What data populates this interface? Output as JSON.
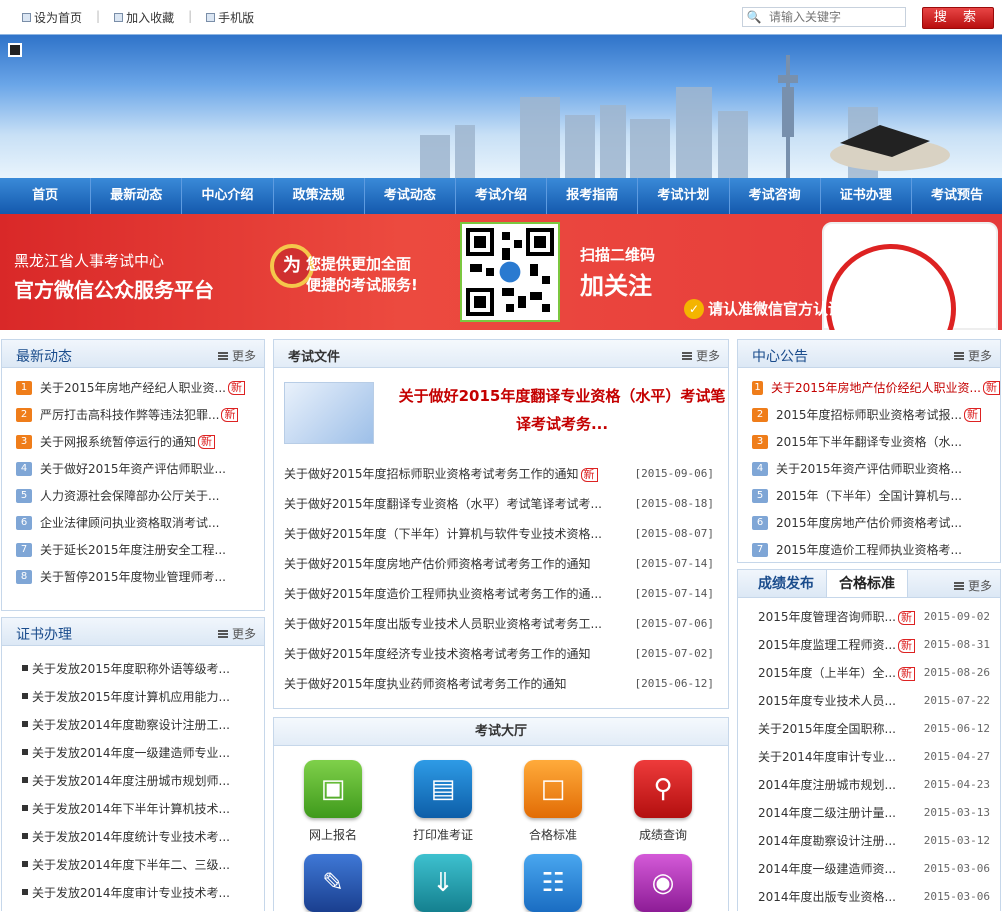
{
  "toplinks": {
    "home": "设为首页",
    "fav": "加入收藏",
    "mobile": "手机版"
  },
  "search": {
    "placeholder": "请输入关键字",
    "button": "搜 索"
  },
  "nav": [
    "首页",
    "最新动态",
    "中心介绍",
    "政策法规",
    "考试动态",
    "考试介绍",
    "报考指南",
    "考试计划",
    "考试咨询",
    "证书办理",
    "考试预告"
  ],
  "wechat": {
    "org": "黑龙江省人事考试中心",
    "platform": "官方微信公众服务平台",
    "badge": "为",
    "slogan1": "您提供更加全面",
    "slogan2": "便捷的考试服务!",
    "scan1": "扫描二维码",
    "scan2": "加关注",
    "verify": "请认准微信官方认证"
  },
  "latest": {
    "title": "最新动态",
    "more": "更多",
    "items": [
      {
        "n": "1",
        "t": "关于2015年房地产经纪人职业资...",
        "new": "新"
      },
      {
        "n": "2",
        "t": "严厉打击高科技作弊等违法犯罪...",
        "new": "新"
      },
      {
        "n": "3",
        "t": "关于网报系统暂停运行的通知",
        "new": "新"
      },
      {
        "n": "4",
        "t": "关于做好2015年资产评估师职业...",
        "new": ""
      },
      {
        "n": "5",
        "t": "人力资源社会保障部办公厅关于...",
        "new": ""
      },
      {
        "n": "6",
        "t": "企业法律顾问执业资格取消考试...",
        "new": ""
      },
      {
        "n": "7",
        "t": "关于延长2015年度注册安全工程...",
        "new": ""
      },
      {
        "n": "8",
        "t": "关于暂停2015年度物业管理师考...",
        "new": ""
      }
    ]
  },
  "cert": {
    "title": "证书办理",
    "more": "更多",
    "items": [
      "关于发放2015年度职称外语等级考...",
      "关于发放2015年度计算机应用能力...",
      "关于发放2014年度勘察设计注册工...",
      "关于发放2014年度一级建造师专业...",
      "关于发放2014年度注册城市规划师...",
      "关于发放2014年下半年计算机技术...",
      "关于发放2014年度统计专业技术考...",
      "关于发放2014年度下半年二、三级...",
      "关于发放2014年度审计专业技术考..."
    ]
  },
  "files": {
    "title": "考试文件",
    "more": "更多",
    "feature": "关于做好2015年度翻译专业资格（水平）考试笔译考试考务...",
    "items": [
      {
        "t": "关于做好2015年度招标师职业资格考试考务工作的通知",
        "new": "新",
        "d": "[2015-09-06]"
      },
      {
        "t": "关于做好2015年度翻译专业资格（水平）考试笔译考试考...",
        "new": "",
        "d": "[2015-08-18]"
      },
      {
        "t": "关于做好2015年度（下半年）计算机与软件专业技术资格...",
        "new": "",
        "d": "[2015-08-07]"
      },
      {
        "t": "关于做好2015年度房地产估价师资格考试考务工作的通知",
        "new": "",
        "d": "[2015-07-14]"
      },
      {
        "t": "关于做好2015年度造价工程师执业资格考试考务工作的通...",
        "new": "",
        "d": "[2015-07-14]"
      },
      {
        "t": "关于做好2015年度出版专业技术人员职业资格考试考务工...",
        "new": "",
        "d": "[2015-07-06]"
      },
      {
        "t": "关于做好2015年度经济专业技术资格考试考务工作的通知",
        "new": "",
        "d": "[2015-07-02]"
      },
      {
        "t": "关于做好2015年度执业药师资格考试考务工作的通知",
        "new": "",
        "d": "[2015-06-12]"
      }
    ]
  },
  "hall": {
    "title": "考试大厅",
    "items": [
      "网上报名",
      "打印准考证",
      "合格标准",
      "成绩查询"
    ]
  },
  "notice": {
    "title": "中心公告",
    "more": "更多",
    "items": [
      {
        "n": "1",
        "t": "关于2015年房地产估价经纪人职业资...",
        "new": "新",
        "red": true
      },
      {
        "n": "2",
        "t": "2015年度招标师职业资格考试报...",
        "new": "新",
        "red": false
      },
      {
        "n": "3",
        "t": "2015年下半年翻译专业资格（水...",
        "new": "",
        "red": false
      },
      {
        "n": "4",
        "t": "关于2015年资产评估师职业资格...",
        "new": "",
        "red": false
      },
      {
        "n": "5",
        "t": "2015年（下半年）全国计算机与...",
        "new": "",
        "red": false
      },
      {
        "n": "6",
        "t": "2015年度房地产估价师资格考试...",
        "new": "",
        "red": false
      },
      {
        "n": "7",
        "t": "2015年度造价工程师执业资格考...",
        "new": "",
        "red": false
      }
    ]
  },
  "scores": {
    "tab1": "成绩发布",
    "tab2": "合格标准",
    "more": "更多",
    "items": [
      {
        "t": "2015年度管理咨询师职...",
        "new": "新",
        "d": "2015-09-02"
      },
      {
        "t": "2015年度监理工程师资...",
        "new": "新",
        "d": "2015-08-31"
      },
      {
        "t": "2015年度（上半年）全...",
        "new": "新",
        "d": "2015-08-26"
      },
      {
        "t": "2015年度专业技术人员...",
        "new": "",
        "d": "2015-07-22"
      },
      {
        "t": "关于2015年度全国职称...",
        "new": "",
        "d": "2015-06-12"
      },
      {
        "t": "关于2014年度审计专业...",
        "new": "",
        "d": "2015-04-27"
      },
      {
        "t": "2014年度注册城市规划...",
        "new": "",
        "d": "2015-04-23"
      },
      {
        "t": "2014年度二级注册计量...",
        "new": "",
        "d": "2015-03-13"
      },
      {
        "t": "2014年度勘察设计注册...",
        "new": "",
        "d": "2015-03-12"
      },
      {
        "t": "2014年度一级建造师资...",
        "new": "",
        "d": "2015-03-06"
      },
      {
        "t": "2014年度出版专业资格...",
        "new": "",
        "d": "2015-03-06"
      }
    ]
  },
  "colors": {
    "accent": "#1459ad",
    "red": "#c40000",
    "orange": "#ef7d1a"
  }
}
